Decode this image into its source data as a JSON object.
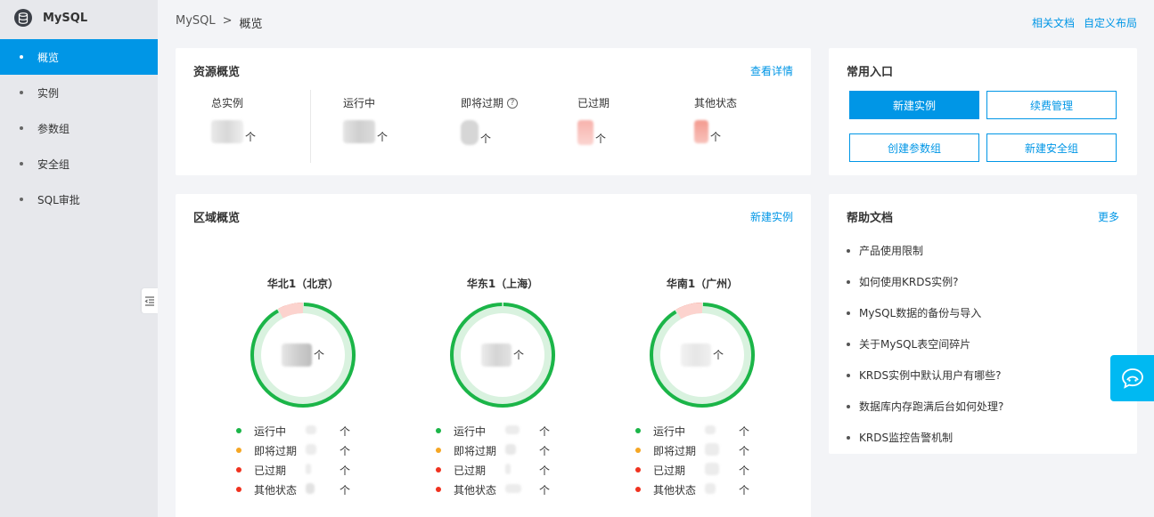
{
  "sidebar": {
    "title": "MySQL",
    "items": [
      {
        "label": "概览",
        "active": true
      },
      {
        "label": "实例"
      },
      {
        "label": "参数组"
      },
      {
        "label": "安全组"
      },
      {
        "label": "SQL审批"
      }
    ]
  },
  "breadcrumb": {
    "root": "MySQL",
    "separator": ">",
    "current": "概览"
  },
  "header_links": {
    "docs": "相关文档",
    "layout": "自定义布局"
  },
  "resource": {
    "title": "资源概览",
    "detail_link": "查看详情",
    "stats": [
      {
        "label": "总实例",
        "unit": "个"
      },
      {
        "label": "运行中",
        "unit": "个"
      },
      {
        "label": "即将过期",
        "unit": "个",
        "help": "?"
      },
      {
        "label": "已过期",
        "unit": "个"
      },
      {
        "label": "其他状态",
        "unit": "个"
      }
    ]
  },
  "entry": {
    "title": "常用入口",
    "buttons": {
      "create_instance": "新建实例",
      "renew": "续费管理",
      "create_param_group": "创建参数组",
      "create_security_group": "新建安全组"
    }
  },
  "region": {
    "title": "区域概览",
    "create_link": "新建实例",
    "unit": "个",
    "legend_labels": [
      "运行中",
      "即将过期",
      "已过期",
      "其他状态"
    ],
    "regions": [
      {
        "name": "华北1（北京）",
        "red_fraction": 0.08
      },
      {
        "name": "华东1（上海）",
        "red_fraction": 0.0
      },
      {
        "name": "华南1（广州）",
        "red_fraction": 0.085
      }
    ]
  },
  "help": {
    "title": "帮助文档",
    "more_link": "更多",
    "items": [
      "产品使用限制",
      "如何使用KRDS实例?",
      "MySQL数据的备份与导入",
      "关于MySQL表空间碎片",
      "KRDS实例中默认用户有哪些?",
      "数据库内存跑满后台如何处理?",
      "KRDS监控告警机制"
    ]
  },
  "colors": {
    "accent": "#0096e6",
    "running": "#1bb548",
    "expiring": "#f5a623",
    "expired": "#f0321f",
    "other": "#f0321f"
  }
}
